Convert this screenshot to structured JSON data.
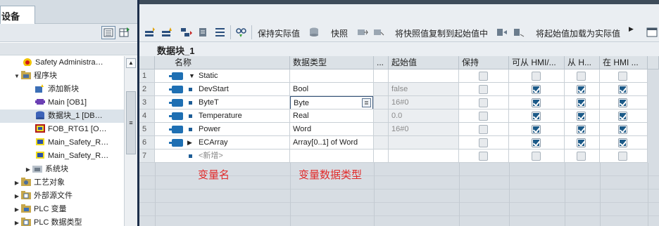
{
  "left_panel": {
    "tab_label": "设备",
    "tree": [
      {
        "label": "Safety Administra…",
        "icon": "safety-admin-icon",
        "indent": 0
      },
      {
        "label": "程序块",
        "icon": "folder-icon",
        "expanded": true
      },
      {
        "label": "添加新块",
        "icon": "add-block-icon"
      },
      {
        "label": "Main [OB1]",
        "icon": "ob-block-icon"
      },
      {
        "label": "数据块_1 [DB…",
        "icon": "data-block-icon",
        "selected": true
      },
      {
        "label": "FOB_RTG1 [O…",
        "icon": "fob-block-icon"
      },
      {
        "label": "Main_Safety_R…",
        "icon": "safety-block-icon"
      },
      {
        "label": "Main_Safety_R…",
        "icon": "safety-block-icon"
      },
      {
        "label": "系统块",
        "icon": "system-block-icon"
      },
      {
        "label": "工艺对象",
        "icon": "tech-object-icon"
      },
      {
        "label": "外部源文件",
        "icon": "external-source-icon"
      },
      {
        "label": "PLC 变量",
        "icon": "plc-tag-icon"
      },
      {
        "label": "PLC 数据类型",
        "icon": "plc-datatype-icon"
      }
    ]
  },
  "toolbar": {
    "keep_actual": "保持实际值",
    "snapshot": "快照",
    "copy_snapshot": "将快照值复制到起始值中",
    "load_start": "将起始值加载为实际值"
  },
  "editor": {
    "block_title": "数据块_1",
    "columns": [
      "名称",
      "数据类型",
      "...",
      "起始值",
      "保持",
      "可从 HMI/...",
      "从 H...",
      "在 HMI ..."
    ],
    "rows": [
      {
        "num": "1",
        "name": "Static",
        "type": "",
        "start": "",
        "section": true
      },
      {
        "num": "2",
        "name": "DevStart",
        "type": "Bool",
        "start": "false",
        "retain": false,
        "hmi1": true,
        "hmi2": true,
        "hmi3": true
      },
      {
        "num": "3",
        "name": "ByteT",
        "type": "Byte",
        "start": "16#0",
        "retain": false,
        "hmi1": true,
        "hmi2": true,
        "hmi3": true,
        "editing": true
      },
      {
        "num": "4",
        "name": "Temperature",
        "type": "Real",
        "start": "0.0",
        "retain": false,
        "hmi1": true,
        "hmi2": true,
        "hmi3": true
      },
      {
        "num": "5",
        "name": "Power",
        "type": "Word",
        "start": "16#0",
        "retain": false,
        "hmi1": true,
        "hmi2": true,
        "hmi3": true
      },
      {
        "num": "6",
        "name": "ECArray",
        "type": "Array[0..1] of Word",
        "start": "",
        "retain": false,
        "hmi1": true,
        "hmi2": true,
        "hmi3": true,
        "expandable": true
      },
      {
        "num": "7",
        "name": "<新增>",
        "type": "",
        "start": "",
        "placeholder": true
      }
    ],
    "annotations": {
      "var_name": "变量名",
      "var_type": "变量数据类型"
    }
  },
  "colors": {
    "accent": "#1e6fb3",
    "checkbox": "#1c5a88",
    "annotation": "#e22b2b"
  }
}
